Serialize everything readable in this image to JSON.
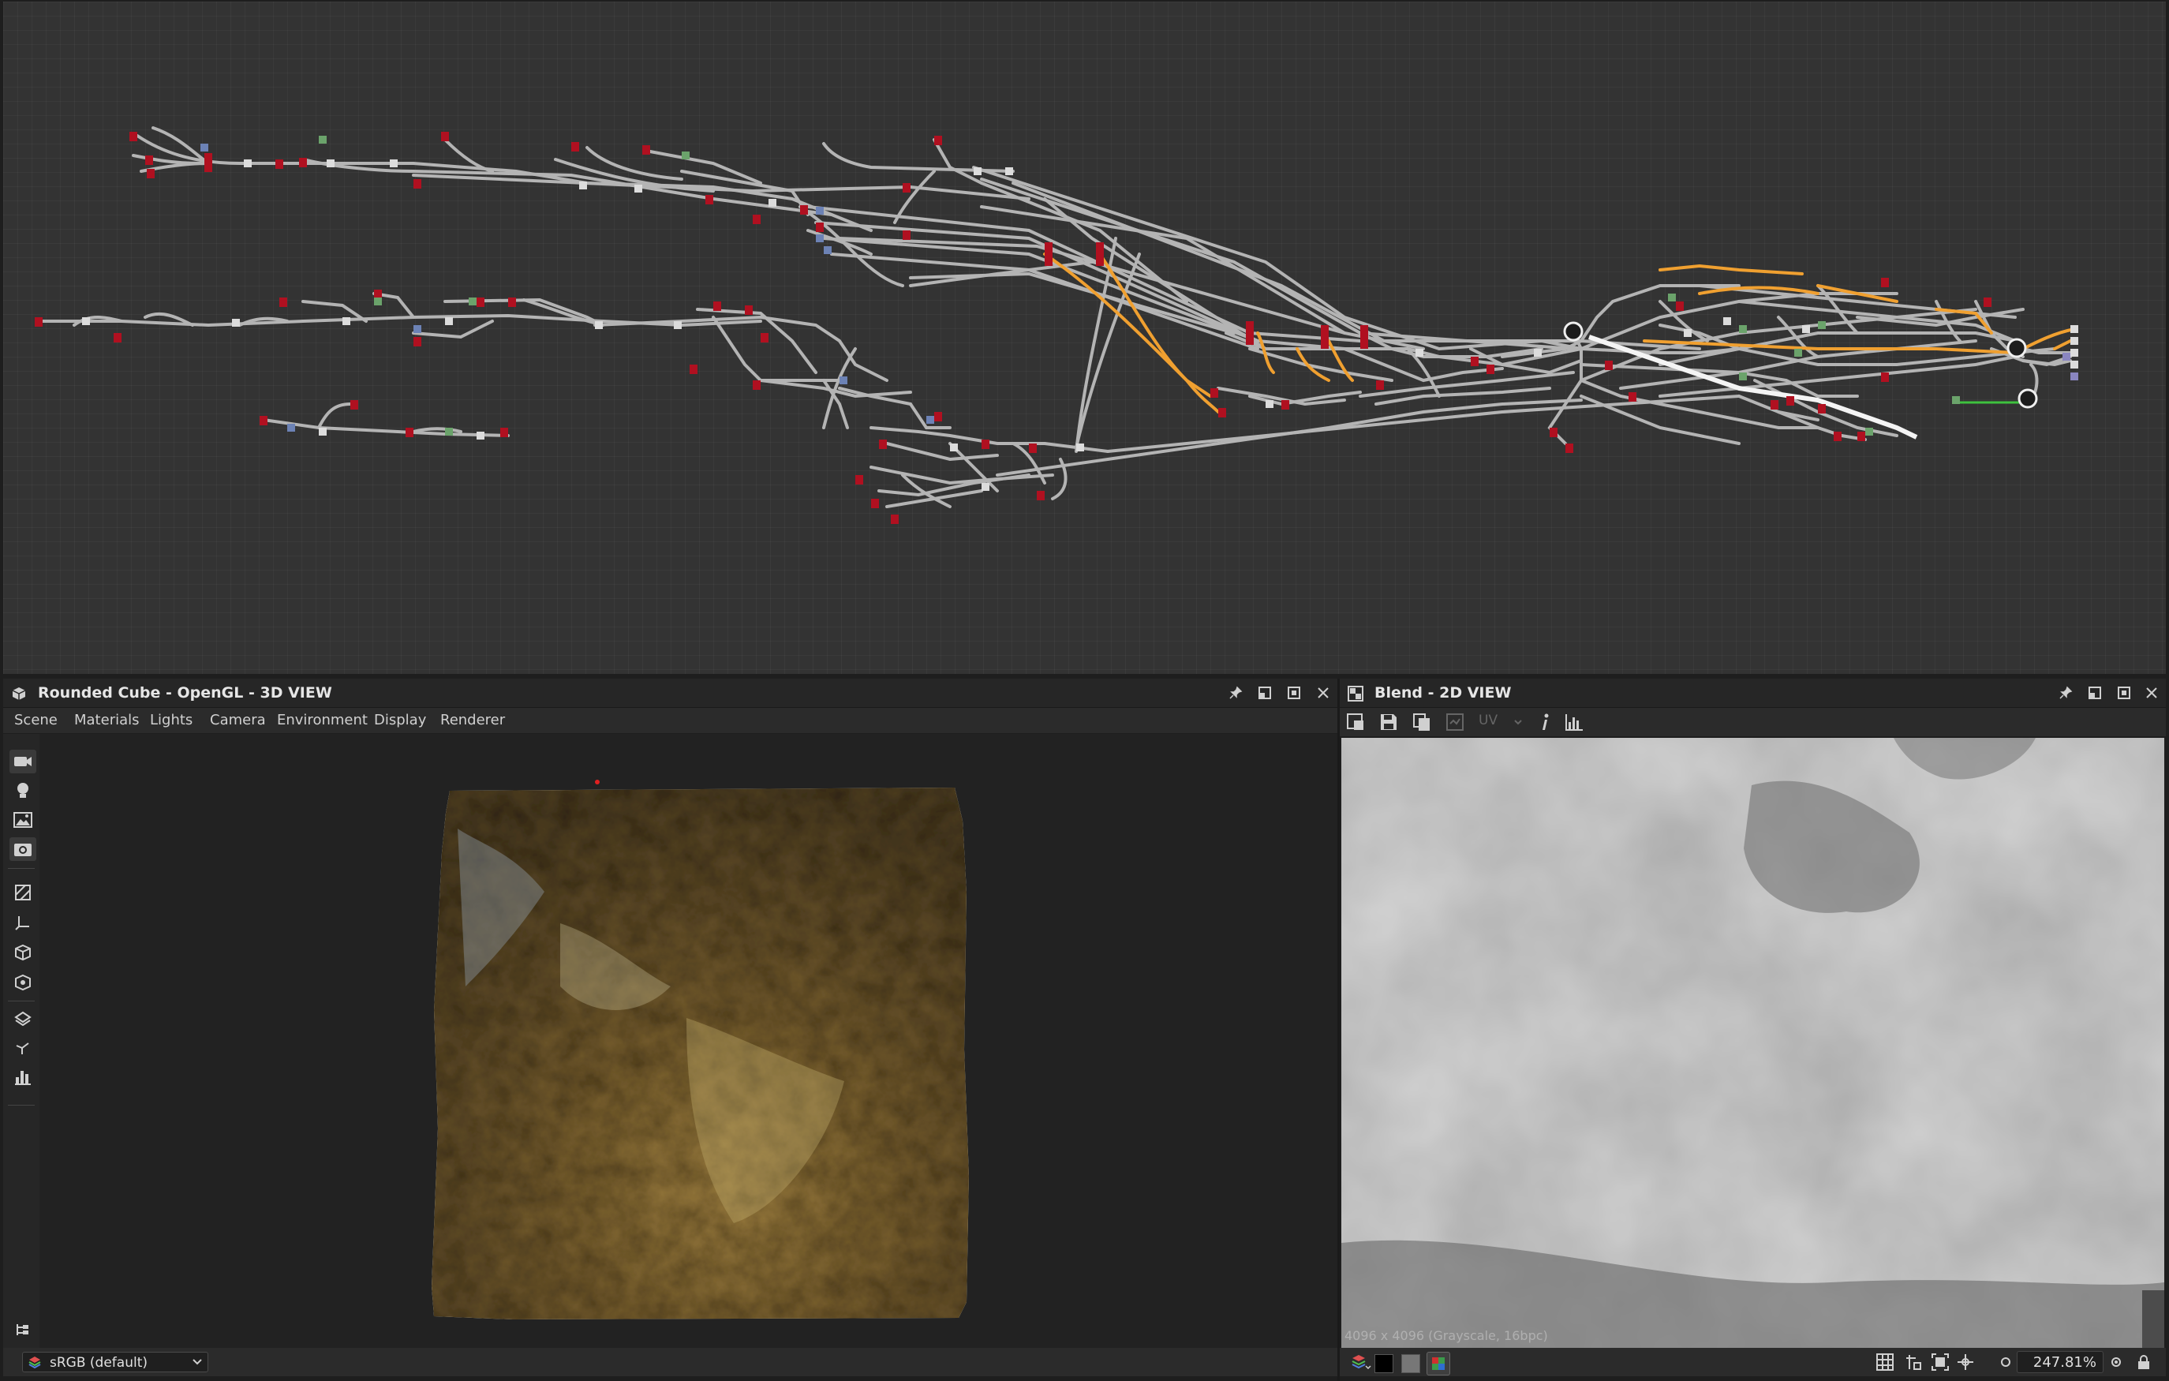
{
  "graph_panel": {
    "name": "node-graph"
  },
  "viewport3d": {
    "title": "Rounded Cube - OpenGL - 3D VIEW",
    "menu": [
      "Scene",
      "Materials",
      "Lights",
      "Camera",
      "Environment",
      "Display",
      "Renderer"
    ],
    "colorspace": "sRGB (default)",
    "tools": [
      "camera-icon",
      "light-bulb-icon",
      "environment-icon",
      "screenshot-icon",
      "uv-grid-icon",
      "axis-icon",
      "cube-icon",
      "cube-wire-icon",
      "plane-icon",
      "gizmo-icon",
      "histogram-icon"
    ]
  },
  "view2d": {
    "title": "Blend - 2D VIEW",
    "toolbar_uv": "UV",
    "image_info": "4096 x 4096 (Grayscale, 16bpc)",
    "zoom": "247.81%"
  },
  "colors": {
    "accent_orange": "#f0a030",
    "port_red": "#b01020",
    "wire_gray": "#b4b4b4",
    "link_green": "#3ec23e"
  }
}
